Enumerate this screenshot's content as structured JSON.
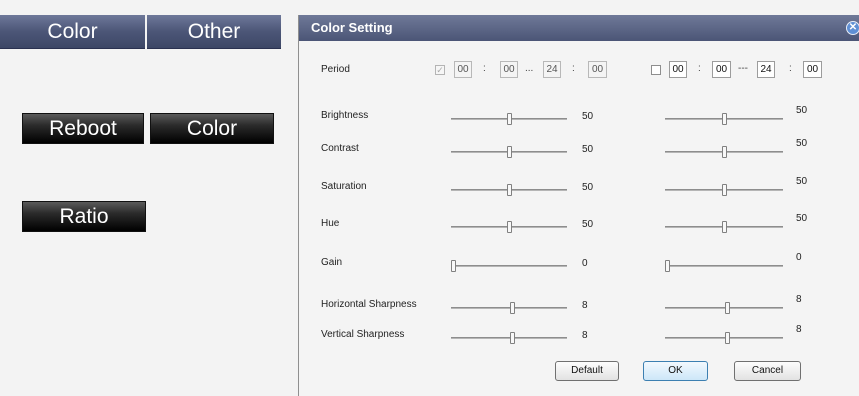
{
  "left_panel": {
    "tabs": [
      "Color",
      "Other"
    ],
    "buttons": {
      "reboot": "Reboot",
      "color": "Color",
      "ratio": "Ratio"
    }
  },
  "dialog": {
    "title": "Color Setting",
    "close_icon": "close-icon",
    "period_label": "Period",
    "period_1": {
      "checked": true,
      "enabled": false,
      "start_h": "00",
      "start_m": "00",
      "end_h": "24",
      "end_m": "00"
    },
    "period_2": {
      "checked": false,
      "enabled": true,
      "start_h": "00",
      "start_m": "00",
      "end_h": "24",
      "end_m": "00"
    },
    "separator_colon": ":",
    "separator_range": "...",
    "separator_range_2": "---",
    "sliders": [
      {
        "label": "Brightness",
        "value_1": "50",
        "value_2": "50",
        "pos_1": 0.5,
        "pos_2": 0.5
      },
      {
        "label": "Contrast",
        "value_1": "50",
        "value_2": "50",
        "pos_1": 0.5,
        "pos_2": 0.5
      },
      {
        "label": "Saturation",
        "value_1": "50",
        "value_2": "50",
        "pos_1": 0.5,
        "pos_2": 0.5
      },
      {
        "label": "Hue",
        "value_1": "50",
        "value_2": "50",
        "pos_1": 0.5,
        "pos_2": 0.5
      },
      {
        "label": "Gain",
        "value_1": "0",
        "value_2": "0",
        "pos_1": 0.0,
        "pos_2": 0.0
      },
      {
        "label": "Horizontal Sharpness",
        "value_1": "8",
        "value_2": "8",
        "pos_1": 0.53,
        "pos_2": 0.53
      },
      {
        "label": "Vertical Sharpness",
        "value_1": "8",
        "value_2": "8",
        "pos_1": 0.53,
        "pos_2": 0.53
      }
    ],
    "buttons": {
      "default": "Default",
      "ok": "OK",
      "cancel": "Cancel"
    }
  }
}
